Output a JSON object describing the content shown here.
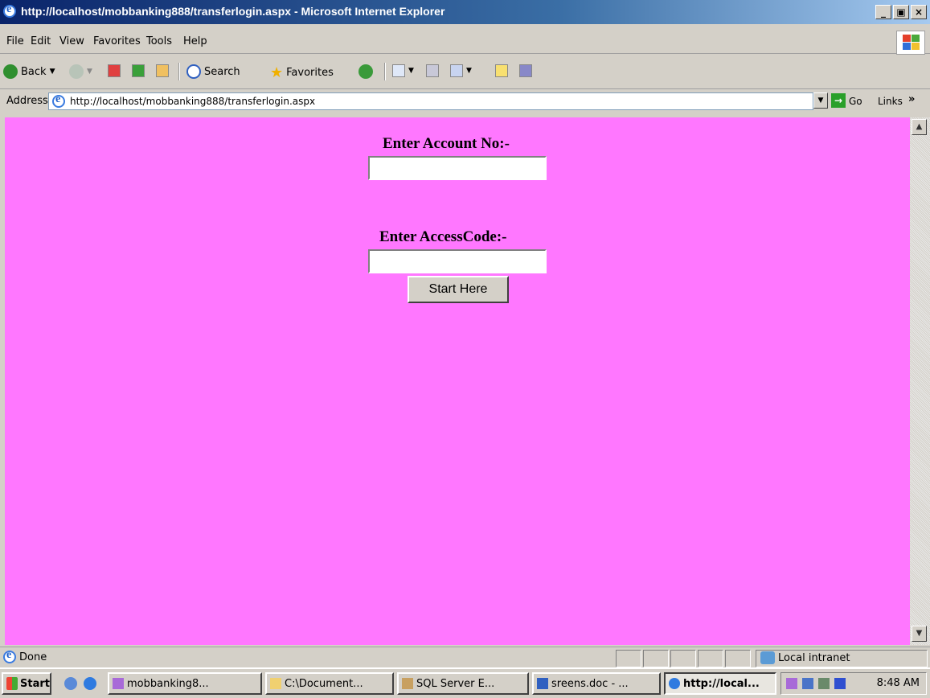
{
  "window": {
    "title": "http://localhost/mobbanking888/transferlogin.aspx - Microsoft Internet Explorer",
    "buttons": [
      "_",
      "×"
    ]
  },
  "menu": [
    "File",
    "Edit",
    "View",
    "Favorites",
    "Tools",
    "Help"
  ],
  "toolbar": {
    "back": "Back",
    "search": "Search",
    "favorites": "Favorites"
  },
  "address": {
    "label": "Address",
    "url": "http://localhost/mobbanking888/transferlogin.aspx",
    "go": "Go",
    "links": "Links"
  },
  "form": {
    "account_label": "Enter Account No:-",
    "account_value": "",
    "access_label": "Enter AccessCode:-",
    "access_value": "",
    "submit_label": "Start Here"
  },
  "status": {
    "text": "Done",
    "zone": "Local intranet"
  },
  "taskbar": {
    "start": "Start",
    "tasks": [
      "mobbanking8...",
      "C:\\Document...",
      "SQL Server E...",
      "sreens.doc - ...",
      "http://local..."
    ],
    "clock": "8:48 AM"
  },
  "colors": {
    "page_background": "#ff77ff",
    "titlebar": "#0a246a",
    "chrome": "#d4d0c8"
  }
}
